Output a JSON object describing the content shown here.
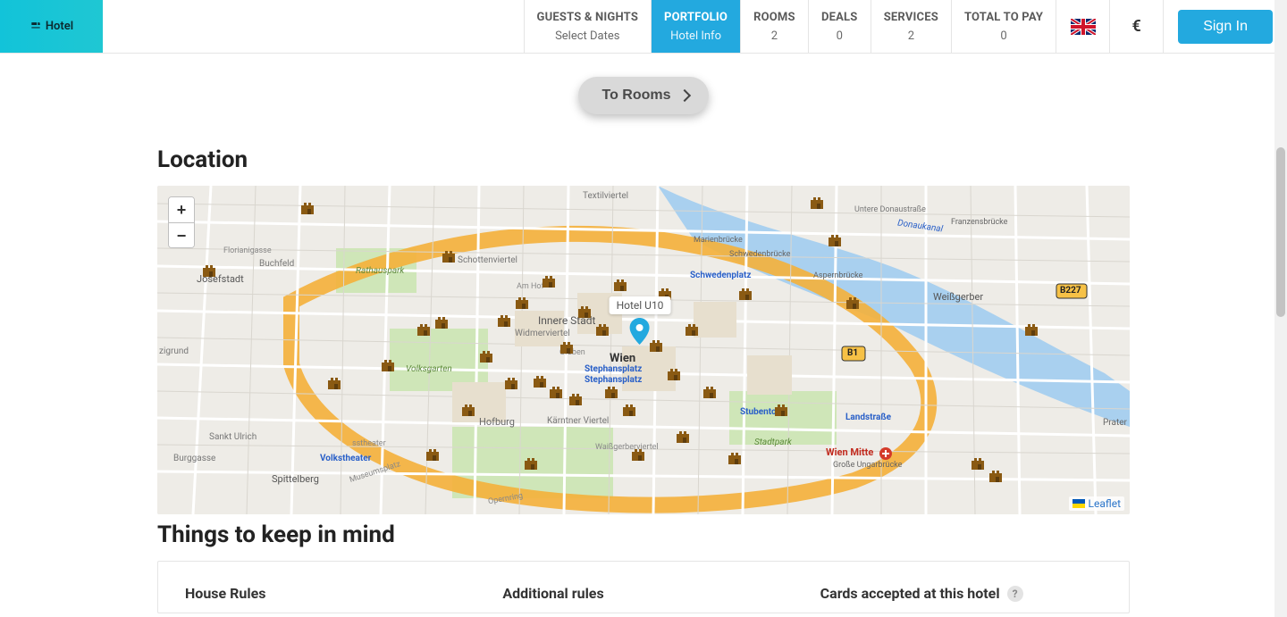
{
  "brand": {
    "name": "Hotel"
  },
  "nav": {
    "guests": {
      "title": "GUESTS & NIGHTS",
      "sub": "Select Dates"
    },
    "portfolio": {
      "title": "PORTFOLIO",
      "sub": "Hotel Info"
    },
    "rooms": {
      "title": "ROOMS",
      "sub": "2"
    },
    "deals": {
      "title": "DEALS",
      "sub": "0"
    },
    "services": {
      "title": "SERVICES",
      "sub": "2"
    },
    "total": {
      "title": "TOTAL TO PAY",
      "sub": "0"
    }
  },
  "currency_symbol": "€",
  "signin_label": "Sign In",
  "to_rooms_label": "To Rooms",
  "location_heading": "Location",
  "map": {
    "hotel_label": "Hotel U10",
    "zoom_in": "+",
    "zoom_out": "−",
    "attribution": "Leaflet",
    "labels": {
      "wien": "Wien",
      "stephansplatz1": "Stephansplatz",
      "stephansplatz2": "Stephansplatz",
      "innere": "Innere Stadt",
      "schwedenplatz": "Schwedenplatz",
      "marienbrucke": "Marienbrücke",
      "schwedenbrucke": "Schwedenbrücke",
      "aspernbrucke": "Aspernbrücke",
      "franzensbrucke": "Franzensbrücke",
      "donaukanal": "Donaukanal",
      "untere": "Untere Donaustraße",
      "stubentor": "Stubentor",
      "stadtpark": "Stadtpark",
      "wien_mitte": "Wien Mitte",
      "landstrasse": "Landstraße",
      "grosse_ung": "Große Ungarbrücke",
      "weissgerber": "Weißgerber",
      "hofburg": "Hofburg",
      "karntner": "Kärntner Viertel",
      "widmerviertel": "Widmerviertel",
      "volksgarten": "Volksgarten",
      "volkstheater": "Volkstheater",
      "rathauspark": "Rathauspark",
      "schottenviertel": "Schottenviertel",
      "textilviertel": "Textilviertel",
      "josefstadt": "Josefstadt",
      "spittelberg": "Spittelberg",
      "burggasse": "Burggasse",
      "sankt_ulrich": "Sankt Ulrich",
      "florianigasse": "Florianigasse",
      "buchfeld": "Buchfeld",
      "zigrund": "zigrund",
      "prater": "Prater",
      "waissg": "Waißgerberviertel",
      "b1": "B1",
      "b227": "B227",
      "amhof": "Am Hof",
      "graben": "Graben",
      "museumsplatz": "Museumsplatz",
      "operring": "Opernring",
      "sstheater": "sstheater"
    }
  },
  "things_heading": "Things to keep in mind",
  "house_rules_title": "House Rules",
  "additional_rules_title": "Additional rules",
  "cards_title": "Cards accepted at this hotel"
}
